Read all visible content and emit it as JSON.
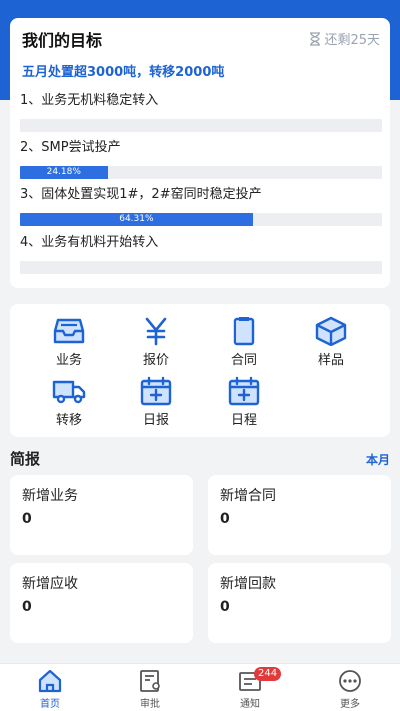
{
  "goal": {
    "title": "我们的目标",
    "days_left": "还剩25天",
    "subtitle": "五月处置超3000吨，转移2000吨",
    "items": [
      {
        "label": "1、业务无机料稳定转入",
        "progress": 0,
        "progress_text": ""
      },
      {
        "label": "2、SMP尝试投产",
        "progress": 0.2418,
        "progress_text": "24.18%"
      },
      {
        "label": "3、固体处置实现1#，2#窑同时稳定投产",
        "progress": 0.6431,
        "progress_text": "64.31%"
      },
      {
        "label": "4、业务有机料开始转入",
        "progress": 0,
        "progress_text": ""
      }
    ]
  },
  "menu": {
    "items": [
      {
        "label": "业务",
        "icon": "inbox-icon"
      },
      {
        "label": "报价",
        "icon": "yen-icon"
      },
      {
        "label": "合同",
        "icon": "clipboard-icon"
      },
      {
        "label": "样品",
        "icon": "cube-icon"
      },
      {
        "label": "转移",
        "icon": "truck-icon"
      },
      {
        "label": "日报",
        "icon": "calendar-plus-icon"
      },
      {
        "label": "日程",
        "icon": "calendar-plus-icon"
      }
    ]
  },
  "briefing": {
    "title": "简报",
    "period_link": "本月",
    "stats": [
      {
        "label": "新增业务",
        "value": "0"
      },
      {
        "label": "新增合同",
        "value": "0"
      },
      {
        "label": "新增应收",
        "value": "0"
      },
      {
        "label": "新增回款",
        "value": "0"
      }
    ]
  },
  "tabbar": {
    "items": [
      {
        "label": "首页",
        "icon": "home-icon"
      },
      {
        "label": "审批",
        "icon": "approval-icon"
      },
      {
        "label": "通知",
        "icon": "notification-icon",
        "badge": "244"
      },
      {
        "label": "更多",
        "icon": "more-icon"
      }
    ]
  },
  "colors": {
    "primary": "#1e63d4",
    "badge": "#e23a3a",
    "icon_fill": "#cfe3ff"
  }
}
